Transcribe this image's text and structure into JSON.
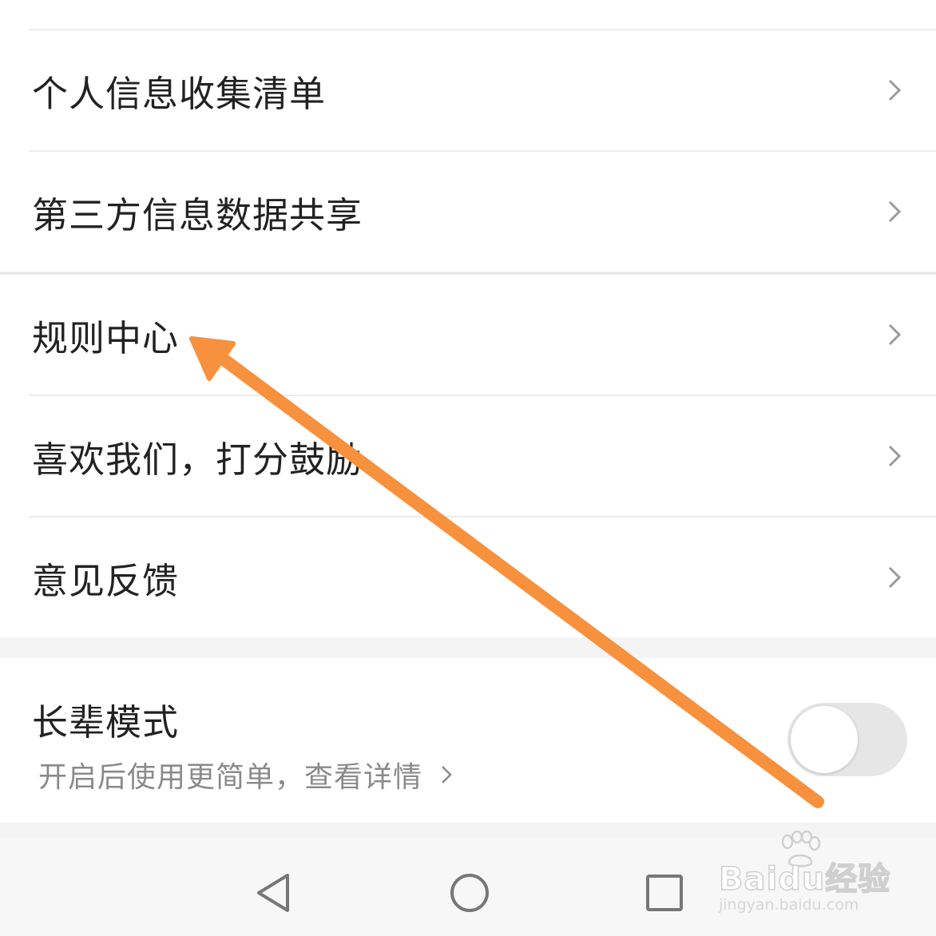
{
  "menu": {
    "items": [
      {
        "label": "个人信息收集清单"
      },
      {
        "label": "第三方信息数据共享"
      },
      {
        "label": "规则中心"
      },
      {
        "label": "喜欢我们，打分鼓励"
      },
      {
        "label": "意见反馈"
      }
    ]
  },
  "elder_mode": {
    "title": "长辈模式",
    "subtitle": "开启后使用更简单，查看详情",
    "toggle_state": "off"
  },
  "navbar": {
    "back_icon": "triangle-back-icon",
    "home_icon": "circle-home-icon",
    "recent_icon": "square-recent-icon"
  },
  "watermark": {
    "brand": "Baidu经验",
    "url": "jingyan.baidu.com"
  },
  "annotation": {
    "color": "#f7913d"
  }
}
